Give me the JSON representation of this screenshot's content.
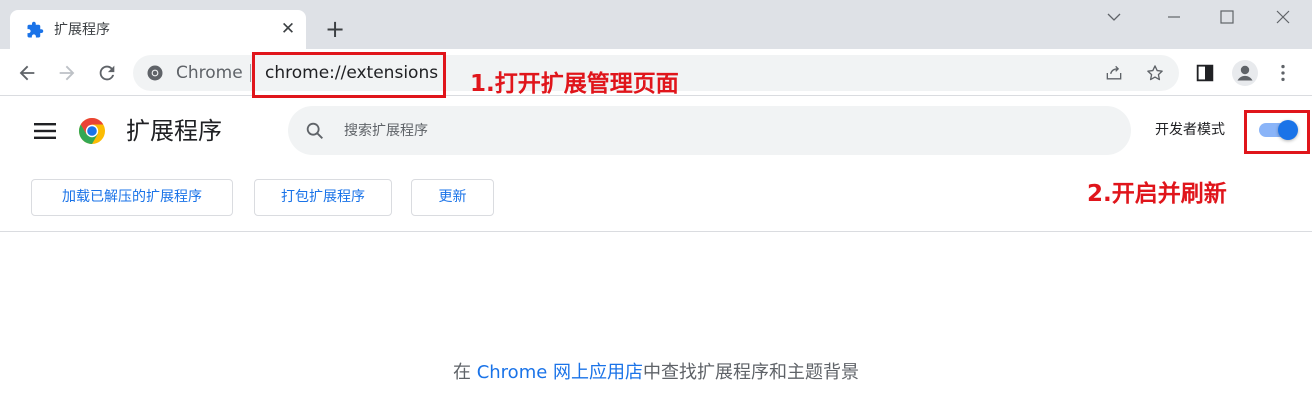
{
  "tab": {
    "title": "扩展程序",
    "close_glyph": "✕",
    "favicon": "puzzle-icon"
  },
  "new_tab_glyph": "+",
  "toolbar": {
    "site_label": "Chrome",
    "url": "chrome://extensions"
  },
  "extensions_page": {
    "title": "扩展程序",
    "search_placeholder": "搜索扩展程序",
    "developer_mode_label": "开发者模式",
    "developer_mode_on": true,
    "buttons": {
      "load_unpacked": "加载已解压的扩展程序",
      "pack": "打包扩展程序",
      "update": "更新"
    },
    "store_prefix": "在 ",
    "store_link": "Chrome 网上应用店",
    "store_suffix": "中查找扩展程序和主题背景"
  },
  "annotations": {
    "step1": "1.打开扩展管理页面",
    "step2": "2.开启并刷新"
  },
  "colors": {
    "accent": "#1a73e8",
    "annotation": "#e0151b",
    "tabstrip": "#dee1e6",
    "toggle_track": "#8ab4f8"
  }
}
